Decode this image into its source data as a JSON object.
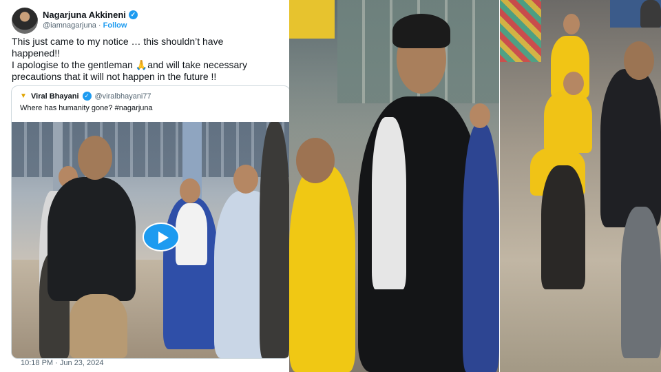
{
  "tweet": {
    "author_name": "Nagarjuna Akkineni",
    "handle": "@iamnagarjuna",
    "separator": "·",
    "follow_label": "Follow",
    "text_lines": [
      "This just came to my notice … this shouldn’t have",
      "happened!!",
      "I apologise to the gentleman 🙏and will take necessary",
      "precautions that it will not happen in the future !!"
    ],
    "timestamp": "10:18 PM · Jun 23, 2024"
  },
  "quote": {
    "author_name": "Viral Bhayani",
    "handle": "@viralbhayani77",
    "text": "Where has humanity gone? #nagarjuna"
  },
  "icons": {
    "verified": "verified-badge-icon",
    "play": "play-icon",
    "quote_logo": "viral-bhayani-logo-icon"
  },
  "colors": {
    "accent": "#1d9bf0",
    "text": "#0f1419",
    "muted": "#536471",
    "border": "#cfd9de"
  }
}
